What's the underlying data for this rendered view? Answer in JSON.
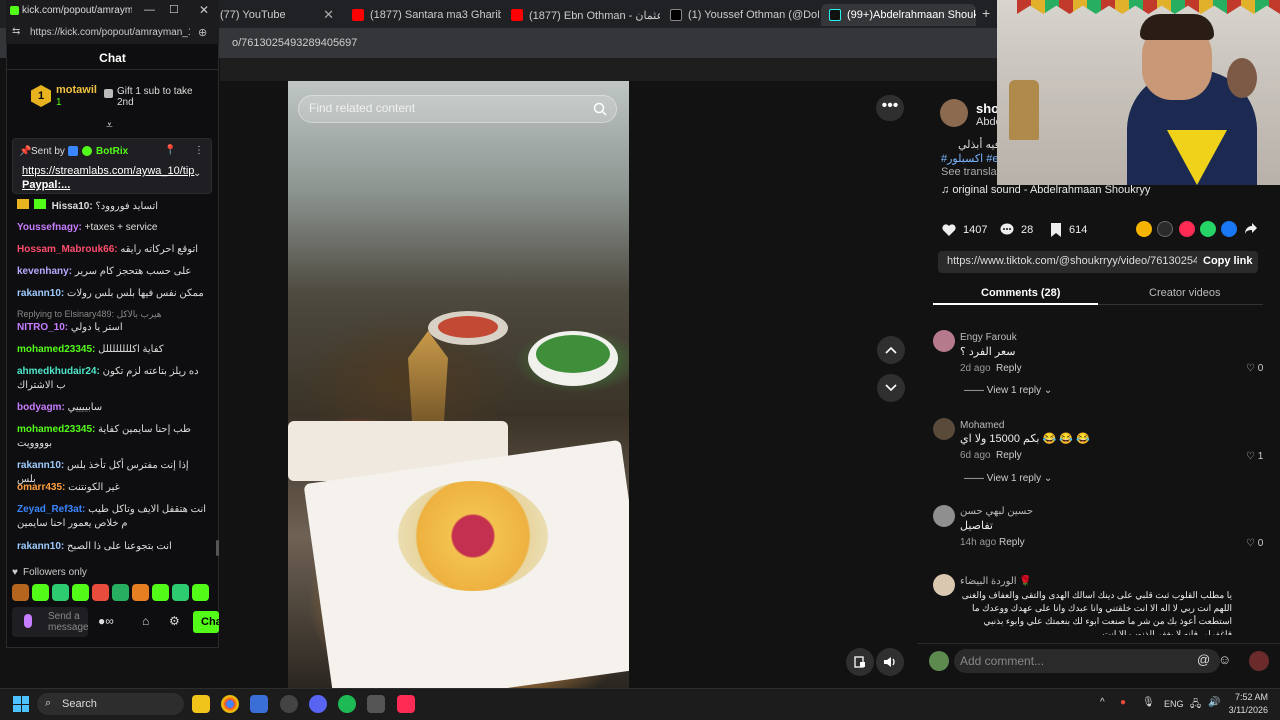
{
  "browser": {
    "tabs": [
      {
        "title": "(77) YouTube",
        "icon": "youtube-icon"
      },
      {
        "title": "(1877) Santara ma3 Gharib - Yo",
        "icon": "youtube-icon"
      },
      {
        "title": "(1877) Ebn Othman - ابن عثمان",
        "icon": "youtube-icon"
      },
      {
        "title": "(1) Youssef Othman (@DoNotC",
        "icon": "x-icon"
      },
      {
        "title": "(99+)Abdelrahmaan Shouk",
        "icon": "tiktok-icon"
      }
    ],
    "url": "o/7613025493289405697",
    "new_tab": "+"
  },
  "video": {
    "search_placeholder": "Find related content",
    "more": "•••"
  },
  "tiktok": {
    "author_name": "sho",
    "author_sub": "Abde",
    "description_ar": "ين بوفيه أبذلي",
    "hashtag": "#اكسبلور #expl",
    "see_translation": "See translati",
    "sound": "original sound - Abdelrahmaan Shoukryy",
    "likes": "1407",
    "comments": "28",
    "saves": "614",
    "link": "https://www.tiktok.com/@shoukrryy/video/7613025493...",
    "copy_link": "Copy link",
    "tab_comments": "Comments (28)",
    "tab_creator": "Creator videos",
    "comment_list": [
      {
        "name": "Engy Farouk",
        "text": "سعر الفرد ؟",
        "time": "2d ago",
        "reply": "Reply",
        "likes": "0",
        "view": "View 1 reply"
      },
      {
        "name": "Mohamed",
        "text": "بكم 15000 ولا اي 😂 😂 😂",
        "time": "6d ago",
        "reply": "Reply",
        "likes": "1",
        "view": "View 1 reply"
      },
      {
        "name": "حسين لبهي حسن",
        "text": "تفاصيل",
        "time": "14h ago",
        "reply": "Reply",
        "likes": "0",
        "view": ""
      },
      {
        "name": "الوردة البيضاء 🌹",
        "text": "يا مطلب القلوب ثبت قلبي على دينك اسالك الهدى والتقى والعفاف والغنى اللهم انت ربي لا اله الا انت خلقتني وانا عبدك وانا على عهدك ووعدك ما استطعت أعوذ بك من شر ما صنعت ابوء لك بنعمتك علي وابوء بذنبي فاغفرلي فإنه لا يغفر الذنوب الا انت",
        "time": "",
        "reply": "",
        "likes": "",
        "view": ""
      }
    ],
    "add_comment": "Add comment..."
  },
  "kick": {
    "popup_title": "kick.com/popout/amrayma",
    "popup_url": "https://kick.com/popout/amrayman_10",
    "chat_header": "Chat",
    "gifter_rank": "1",
    "gifter_name": "motawil",
    "gifter_count": "1",
    "gift_cta": "Gift 1 sub to take 2nd",
    "pinned_sent_by": "Sent by",
    "pinned_bot": "BotRix",
    "pinned_link": "https://streamlabs.com/aywa_10/tip",
    "pinned_suffix": "Paypal:...",
    "messages": [
      {
        "user": "Hissa10:",
        "color": "#dddddd",
        "text": "اتسايد فوروود؟"
      },
      {
        "user": "Youssefnagy:",
        "color": "#c77dff",
        "text": "+taxes + service"
      },
      {
        "user": "Hossam_Mabrouk66:",
        "color": "#ff4d6d",
        "text": "اتوقع احركاته رايقه"
      },
      {
        "user": "kevenhany:",
        "color": "#b9a7ff",
        "text": "على حسب هتحجز كام سرير"
      },
      {
        "user": "rakann10:",
        "color": "#9ecbff",
        "text": "ممكن نفس فيها بلس بلس رولات"
      },
      {
        "user": "NITRO_10:",
        "color": "#c77dff",
        "text": "استر يا دولي",
        "reply_to": "Replying to Elsinary489: هيرب بالاكل"
      },
      {
        "user": "mohamed23345:",
        "color": "#53fc18",
        "text": "كفاية اكللللللللل"
      },
      {
        "user": "ahmedkhudair24:",
        "color": "#4ee7c9",
        "text": "ده ريلز بتاعته لزم تكون ب الاشتراك"
      },
      {
        "user": "bodyagm:",
        "color": "#c77dff",
        "text": "سابييييي"
      },
      {
        "user": "mohamed23345:",
        "color": "#53fc18",
        "text": "طب إحنا سايمين كفاية بوووويت"
      },
      {
        "user": "rakann10:",
        "color": "#9ecbff",
        "text": "إذا إنت مفترس أكل تأخذ بلس بلس"
      },
      {
        "user": "omarr435:",
        "color": "#ff9f40",
        "text": "غير الكونتنت"
      },
      {
        "user": "Zeyad_Ref3at:",
        "color": "#3a86ff",
        "text": "انت هتقفل الايف وتاكل طيب م خلاص يعمور احنا سايمين"
      },
      {
        "user": "rakann10:",
        "color": "#9ecbff",
        "text": "انت بتجوعنا على ذا الصبح"
      }
    ],
    "followers_only": "Followers only",
    "send_placeholder": "Send a message",
    "chat_button": "Cha"
  },
  "taskbar": {
    "search": "Search",
    "lang": "ENG",
    "time": "7:52 AM",
    "date": "3/11/2026"
  }
}
